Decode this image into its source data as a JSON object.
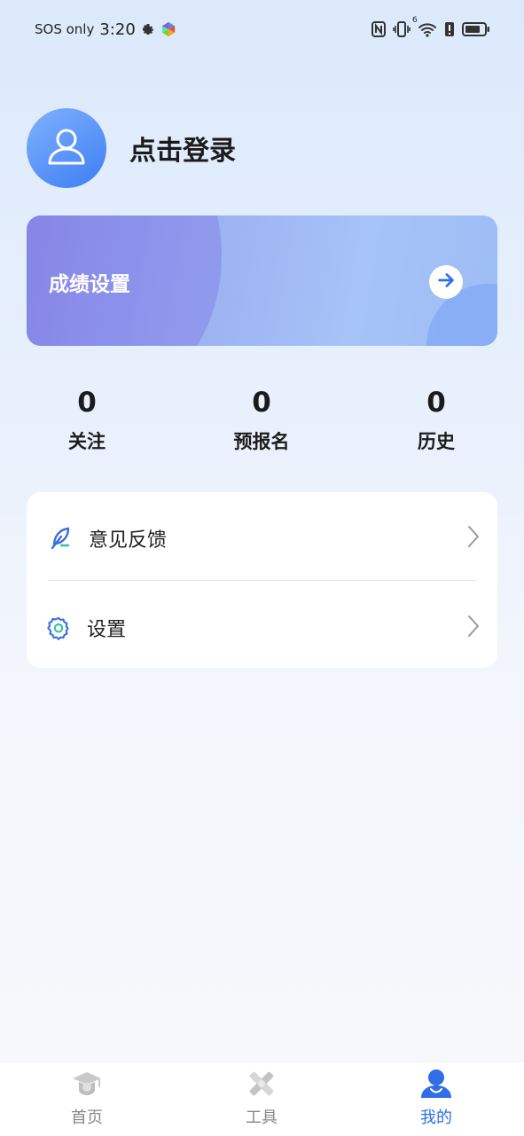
{
  "status_bar": {
    "carrier": "SOS only",
    "time": "3:20",
    "icons": [
      "gear-icon",
      "app-logo-icon",
      "nfc-icon",
      "vibrate-icon",
      "wifi-icon",
      "alert-icon",
      "battery-icon"
    ],
    "wifi_badge": "6"
  },
  "profile": {
    "login_text": "点击登录",
    "avatar_icon": "person-icon"
  },
  "score_card": {
    "title": "成绩设置",
    "arrow_icon": "arrow-right-icon"
  },
  "stats": [
    {
      "value": "0",
      "label": "关注"
    },
    {
      "value": "0",
      "label": "预报名"
    },
    {
      "value": "0",
      "label": "历史"
    }
  ],
  "menu": [
    {
      "label": "意见反馈",
      "icon": "feather-pen-icon"
    },
    {
      "label": "设置",
      "icon": "gear-icon"
    }
  ],
  "tabbar": {
    "items": [
      {
        "label": "首页",
        "icon": "graduation-cap-icon",
        "active": false
      },
      {
        "label": "工具",
        "icon": "tools-icon",
        "active": false
      },
      {
        "label": "我的",
        "icon": "user-icon",
        "active": true
      }
    ]
  },
  "colors": {
    "accent": "#2f6ee6",
    "inactive": "#888888",
    "avatar": "#4a8af5"
  }
}
